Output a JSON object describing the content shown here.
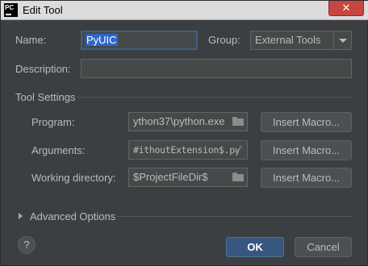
{
  "window": {
    "title": "Edit Tool",
    "app_icon_text": "PC",
    "close_symbol": "✕"
  },
  "form": {
    "name_label": "Name:",
    "name_value": "PyUIC",
    "group_label": "Group:",
    "group_value": "External Tools",
    "description_label": "Description:",
    "description_value": ""
  },
  "tool_settings": {
    "title": "Tool Settings",
    "program_label": "Program:",
    "program_value": "ython37\\python.exe",
    "arguments_label": "Arguments:",
    "arguments_value": "#ithoutExtension$.py",
    "working_dir_label": "Working directory:",
    "working_dir_value": "$ProjectFileDir$",
    "insert_macro_label": "Insert Macro..."
  },
  "advanced": {
    "label": "Advanced Options"
  },
  "footer": {
    "help_label": "?",
    "ok_label": "OK",
    "cancel_label": "Cancel"
  },
  "colors": {
    "background": "#3c3f41",
    "field": "#45494a",
    "primary": "#365880",
    "selection": "#2f65ca",
    "close": "#c7463f"
  }
}
